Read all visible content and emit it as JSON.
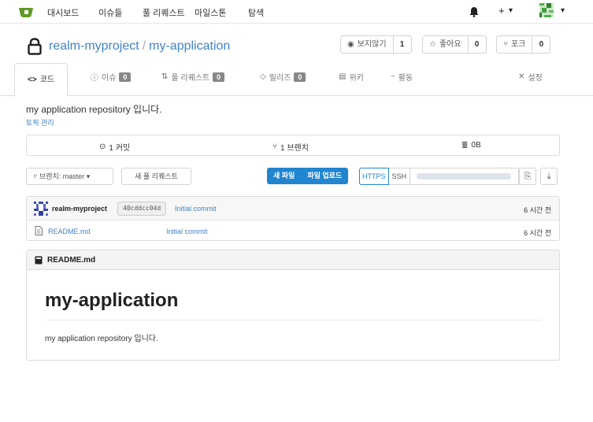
{
  "nav": {
    "items": [
      "대시보드",
      "이슈들",
      "풀 리퀘스트",
      "마일스톤",
      "탐색"
    ],
    "plus": "+",
    "caret": "▾"
  },
  "repo": {
    "owner": "realm-myproject",
    "separator": "/",
    "name": "my-application",
    "watch_label": "보지않기",
    "watch_count": "1",
    "star_label": "좋아요",
    "star_count": "0",
    "fork_label": "포크",
    "fork_count": "0"
  },
  "tabs": [
    {
      "label": "코드",
      "icon": "<>",
      "badge": ""
    },
    {
      "label": "이슈",
      "icon": "ⓘ",
      "badge": "0"
    },
    {
      "label": "풀 리퀘스트",
      "icon": "⇅",
      "badge": "0"
    },
    {
      "label": "릴리즈",
      "icon": "◇",
      "badge": "0"
    },
    {
      "label": "위키",
      "icon": "▤",
      "badge": ""
    },
    {
      "label": "활동",
      "icon": "~",
      "badge": ""
    },
    {
      "label": "설정",
      "icon": "✕",
      "badge": ""
    }
  ],
  "description": "my application repository 입니다.",
  "topic_link": "토픽 관리",
  "stats": {
    "commits": "1 커밋",
    "branches": "1 브렌치",
    "size": "0B"
  },
  "toolbar": {
    "branch_label": "브렌치: master",
    "new_pr": "새 풀 리퀘스트",
    "new_file": "새 파일",
    "upload_file": "파일 업로드",
    "https": "HTTPS",
    "ssh": "SSH"
  },
  "latest_commit": {
    "user": "realm-myproject",
    "sha": "40cddcc04d",
    "message": "Initial commit",
    "time": "6 시간 전"
  },
  "files": [
    {
      "name": "README.md",
      "message": "Initial commit",
      "time": "6 시간 전"
    }
  ],
  "readme": {
    "filename": "README.md",
    "heading": "my-application",
    "body": "my application repository 입니다."
  },
  "colors": {
    "accent": "#2185d0",
    "link": "#4183c4",
    "logo": "#609926"
  }
}
